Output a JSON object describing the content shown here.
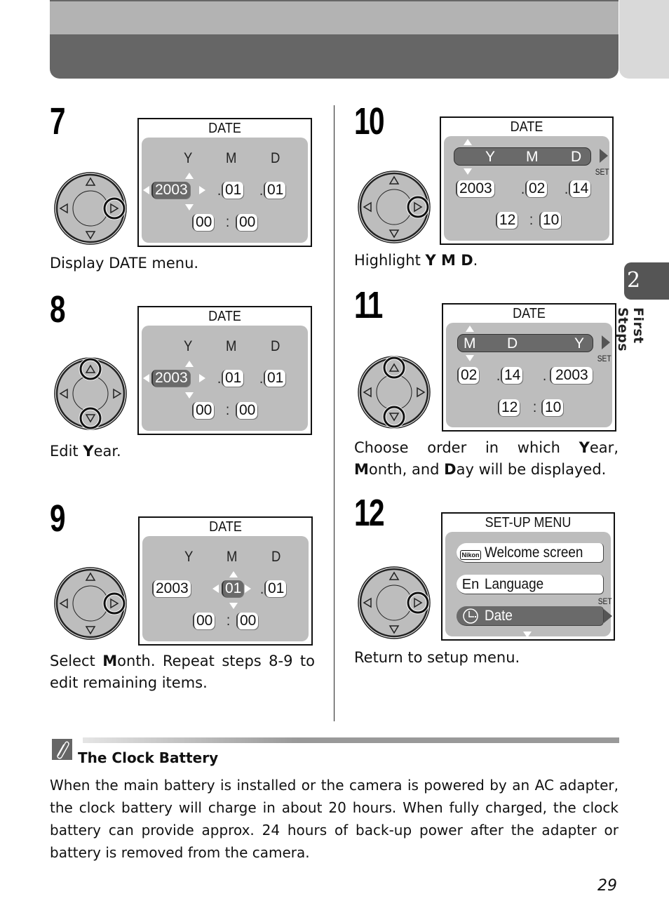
{
  "chapter": {
    "number": "2",
    "title": "First Steps"
  },
  "page_number": "29",
  "steps": [
    {
      "number": "7",
      "caption": "Display DATE menu.",
      "dial_highlight": [
        "right"
      ],
      "screen": {
        "title": "DATE",
        "headers": [
          "Y",
          "M",
          "D"
        ],
        "year": "2003",
        "month": "01",
        "day": "01",
        "hour": "00",
        "minute": "00",
        "selected": "year"
      }
    },
    {
      "number": "8",
      "caption_parts": [
        "Edit ",
        "Y",
        "ear."
      ],
      "dial_highlight": [
        "up",
        "down"
      ],
      "screen": {
        "title": "DATE",
        "headers": [
          "Y",
          "M",
          "D"
        ],
        "year": "2003",
        "month": "01",
        "day": "01",
        "hour": "00",
        "minute": "00",
        "selected": "year"
      }
    },
    {
      "number": "9",
      "caption_parts": [
        "Select ",
        "M",
        "onth. Repeat steps 8-9 to edit remaining items."
      ],
      "dial_highlight": [
        "right"
      ],
      "screen": {
        "title": "DATE",
        "headers": [
          "Y",
          "M",
          "D"
        ],
        "year": "2003",
        "month": "01",
        "day": "01",
        "hour": "00",
        "minute": "00",
        "selected": "month"
      }
    },
    {
      "number": "10",
      "caption_parts": [
        "Highlight ",
        "Y M D",
        "."
      ],
      "dial_highlight": [
        "right"
      ],
      "screen": {
        "title": "DATE",
        "order": [
          "Y",
          "M",
          "D"
        ],
        "values": [
          "2003",
          "02",
          "14"
        ],
        "hour": "12",
        "minute": "10",
        "set_label": "SET",
        "selected": "order"
      }
    },
    {
      "number": "11",
      "caption_parts": [
        "Choose order in which ",
        "Y",
        "ear, ",
        "M",
        "onth, and ",
        "D",
        "ay will be displayed."
      ],
      "dial_highlight": [
        "up",
        "down"
      ],
      "screen": {
        "title": "DATE",
        "order": [
          "M",
          "D",
          "Y"
        ],
        "values": [
          "02",
          "14",
          "2003"
        ],
        "hour": "12",
        "minute": "10",
        "set_label": "SET",
        "selected": "order"
      }
    },
    {
      "number": "12",
      "caption": "Return to setup menu.",
      "dial_highlight": [
        "right"
      ],
      "screen": {
        "title": "SET-UP MENU",
        "items": [
          {
            "icon": "nikon-icon",
            "icon_text": "Nikon",
            "label": "Welcome screen",
            "selected": false
          },
          {
            "icon": "language-en-icon",
            "icon_text": "En",
            "label": "Language",
            "selected": false
          },
          {
            "icon": "clock-icon",
            "icon_text": "",
            "label": "Date",
            "selected": true
          }
        ],
        "set_label": "SET"
      }
    }
  ],
  "note": {
    "icon": "paperclip-note-icon",
    "title": "The Clock Battery",
    "body": "When the main battery is installed or the camera is powered by an AC adapter, the clock battery will charge in about 20 hours. When fully charged, the clock battery can provide approx. 24 hours of back-up power after the adapter or battery is removed from the camera."
  }
}
